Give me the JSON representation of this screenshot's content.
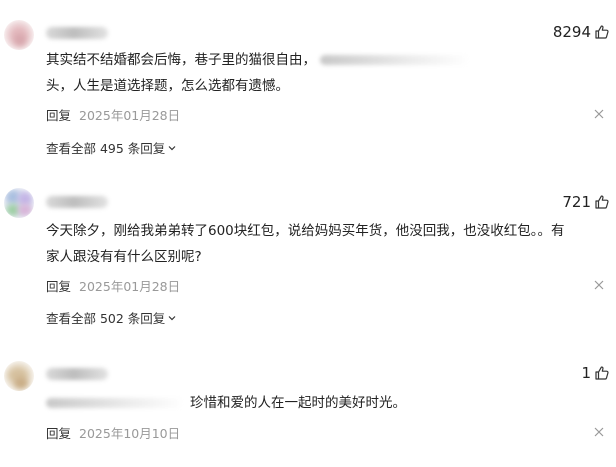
{
  "comments": [
    {
      "likes": "8294",
      "text_line1": "其实结不结婚都会后悔，巷子里的猫很自由，",
      "text_line2": "头，人生是道选择题，怎么选都有遗憾。",
      "reply_label": "回复",
      "date": "2025年01月28日",
      "view_all_label": "查看全部 495 条回复"
    },
    {
      "likes": "721",
      "text_line1": "今天除夕，刚给我弟弟转了600块红包，说给妈妈买年货，他没回我，也没收红包。。有",
      "text_line2": "家人跟没有有什么区别呢?",
      "reply_label": "回复",
      "date": "2025年01月28日",
      "view_all_label": "查看全部 502 条回复"
    },
    {
      "likes": "1",
      "text_line1": "珍惜和爱的人在一起时的美好时光。",
      "reply_label": "回复",
      "date": "2025年10月10日"
    }
  ],
  "icons": {
    "like": "thumbs-up-icon",
    "more": "close-icon",
    "expand": "chevron-down-icon"
  },
  "colors": {
    "text": "#222222",
    "date": "#999999",
    "background": "#ffffff"
  }
}
